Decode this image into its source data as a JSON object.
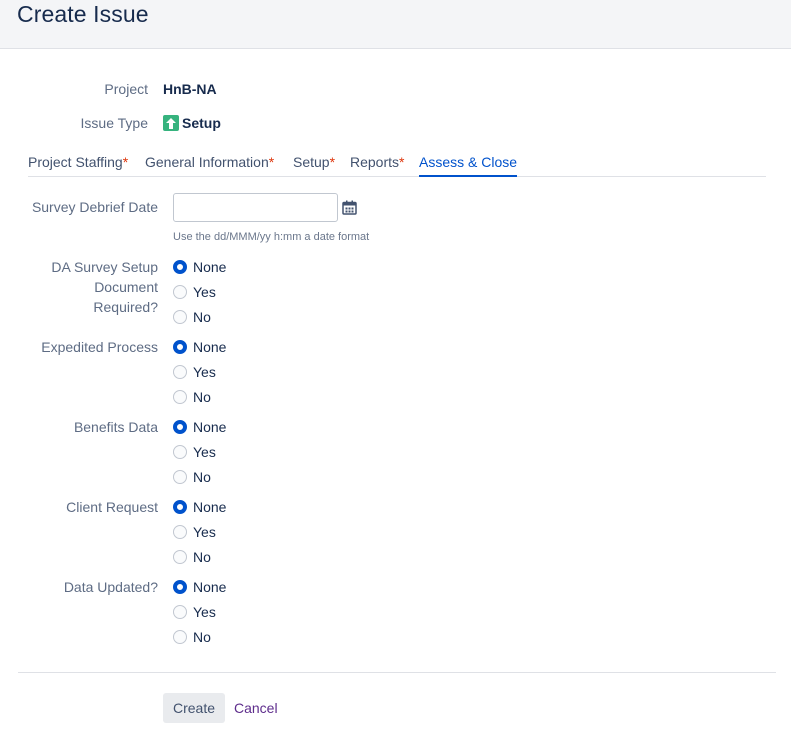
{
  "header": {
    "title": "Create Issue"
  },
  "fields": {
    "project": {
      "label": "Project",
      "value": "HnB-NA"
    },
    "issue_type": {
      "label": "Issue Type",
      "value": "Setup",
      "icon": "arrow-up-icon",
      "icon_color": "#36b37e"
    }
  },
  "tabs": [
    {
      "label": "Project Staffing",
      "required": "*"
    },
    {
      "label": "General Information",
      "required": "*"
    },
    {
      "label": "Setup",
      "required": "*"
    },
    {
      "label": "Reports",
      "required": "*"
    },
    {
      "label": "Assess & Close",
      "required": ""
    }
  ],
  "active_tab": "Assess & Close",
  "survey_debrief": {
    "label": "Survey Debrief Date",
    "value": "",
    "placeholder": "",
    "hint": "Use the dd/MMM/yy h:mm a date format",
    "icon": "calendar-icon"
  },
  "radio_groups": [
    {
      "label_lines": [
        "DA Survey Setup",
        "Document",
        "Required?"
      ],
      "options": [
        "None",
        "Yes",
        "No"
      ],
      "selected": "None"
    },
    {
      "label_lines": [
        "Expedited Process"
      ],
      "options": [
        "None",
        "Yes",
        "No"
      ],
      "selected": "None"
    },
    {
      "label_lines": [
        "Benefits Data"
      ],
      "options": [
        "None",
        "Yes",
        "No"
      ],
      "selected": "None"
    },
    {
      "label_lines": [
        "Client Request"
      ],
      "options": [
        "None",
        "Yes",
        "No"
      ],
      "selected": "None"
    },
    {
      "label_lines": [
        "Data Updated?"
      ],
      "options": [
        "None",
        "Yes",
        "No"
      ],
      "selected": "None"
    }
  ],
  "footer": {
    "create_label": "Create",
    "cancel_label": "Cancel"
  },
  "colors": {
    "accent": "#0052cc",
    "required": "#de350b",
    "cancel_link": "#5e2d8c"
  }
}
